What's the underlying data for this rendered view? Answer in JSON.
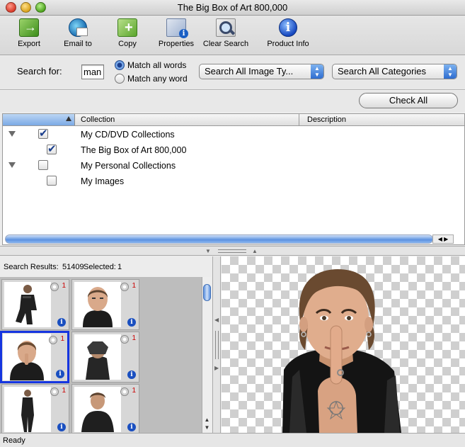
{
  "window": {
    "title": "The Big Box of Art 800,000"
  },
  "toolbar": {
    "items": [
      {
        "label": "Export",
        "icon": "export-icon"
      },
      {
        "label": "Email to",
        "icon": "email-icon"
      },
      {
        "label": "Copy",
        "icon": "copy-icon"
      },
      {
        "label": "Properties",
        "icon": "properties-icon"
      },
      {
        "label": "Clear Search",
        "icon": "magnifier-icon"
      },
      {
        "label": "Product Info",
        "icon": "info-icon"
      }
    ]
  },
  "search": {
    "label": "Search for:",
    "value": "man",
    "match_all": "Match all words",
    "match_any": "Match any word",
    "selected_match": "all",
    "image_type": "Search All Image Ty...",
    "category": "Search All Categories"
  },
  "check_all_label": "Check All",
  "collections": {
    "headers": {
      "collection": "Collection",
      "description": "Description"
    },
    "rows": [
      {
        "name": "My CD/DVD Collections",
        "checked": true,
        "level": 0
      },
      {
        "name": "The Big Box of Art 800,000",
        "checked": true,
        "level": 1
      },
      {
        "name": "My Personal Collections",
        "checked": false,
        "level": 0
      },
      {
        "name": "My Images",
        "checked": false,
        "level": 1
      }
    ]
  },
  "results": {
    "label": "Search Results:",
    "count": "51409",
    "selected_label": "Selected:",
    "selected": "1",
    "thumbs": [
      {
        "count": "1",
        "selected": false
      },
      {
        "count": "1",
        "selected": false
      },
      {
        "count": "1",
        "selected": true
      },
      {
        "count": "1",
        "selected": false
      },
      {
        "count": "1",
        "selected": false
      },
      {
        "count": "1",
        "selected": false
      }
    ]
  },
  "status": "Ready",
  "colors": {
    "selection_border": "#1535e0",
    "accent_blue": "#3c79d4",
    "count_red": "#cc0000"
  }
}
